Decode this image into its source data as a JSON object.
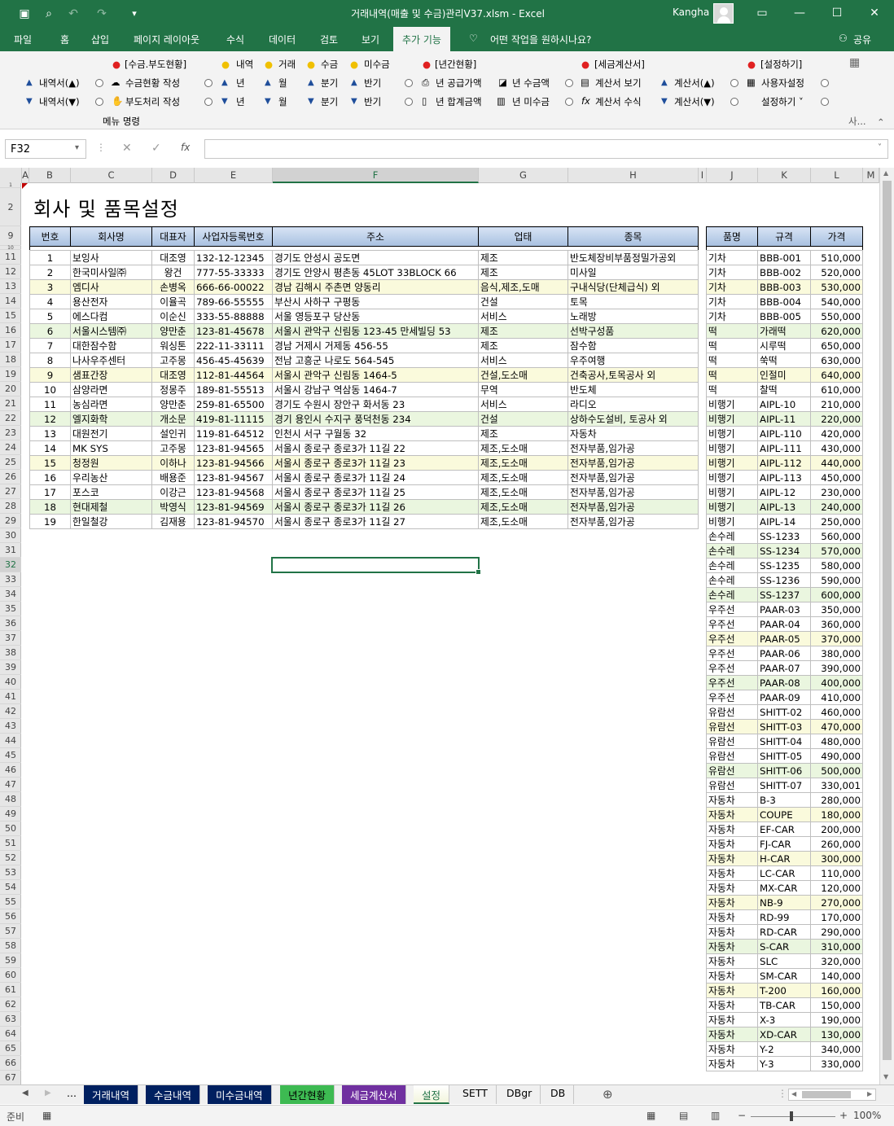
{
  "window": {
    "title": "거래내역(매출 및 수금)관리V37.xlsm  -  Excel",
    "user": "Kangha"
  },
  "menu": {
    "tabs": [
      "파일",
      "홈",
      "삽입",
      "페이지 레이아웃",
      "수식",
      "데이터",
      "검토",
      "보기",
      "추가 기능"
    ],
    "search": "어떤 작업을 원하시나요?",
    "share": "공유"
  },
  "ribbon": {
    "group_headers": [
      "[수금.부도현황]",
      "내역",
      "거래",
      "수금",
      "미수금",
      "[년간현황]",
      "[세금계산서]",
      "[설정하기]"
    ],
    "row1": [
      "내역서(▲)",
      "수금현황 작성",
      "년",
      "월",
      "분기",
      "반기",
      "년 공급가액",
      "년 수금액",
      "계산서 보기",
      "계산서(▲)",
      "사용자설정"
    ],
    "row2": [
      "내역서(▼)",
      "부도처리 작성",
      "년",
      "월",
      "분기",
      "반기",
      "년 합계금액",
      "년 미수금",
      "계산서 수식",
      "계산서(▼)",
      "설정하기 ˅"
    ],
    "caption": "메뉴 명령",
    "caption2": "사..."
  },
  "formula_bar": {
    "name_box": "F32",
    "value": ""
  },
  "columns": [
    "A",
    "B",
    "C",
    "D",
    "E",
    "F",
    "G",
    "H",
    "I",
    "J",
    "K",
    "L",
    "M"
  ],
  "sheet": {
    "title": "회사 및 품목설정",
    "company_headers": [
      "번호",
      "회사명",
      "대표자",
      "사업자등록번호",
      "주소",
      "업태",
      "종목"
    ],
    "companies": [
      [
        "1",
        "보잉사",
        "대조영",
        "132-12-12345",
        "경기도 안성시 공도면",
        "제조",
        "반도체장비부품정밀가공외"
      ],
      [
        "2",
        "한국미사일㈜",
        "왕건",
        "777-55-33333",
        "경기도 안양시 평촌동 45LOT 33BLOCK 66",
        "제조",
        "미사일"
      ],
      [
        "3",
        "엠디사",
        "손병옥",
        "666-66-00022",
        "경남 김해시 주촌면 양동리",
        "음식,제조,도매",
        "구내식당(단체급식) 외"
      ],
      [
        "4",
        "용산전자",
        "이율곡",
        "789-66-55555",
        "부산시 사하구 구평동",
        "건설",
        "토목"
      ],
      [
        "5",
        "에스다컴",
        "이순신",
        "333-55-88888",
        "서울 영등포구 당산동",
        "서비스",
        "노래방"
      ],
      [
        "6",
        "서울시스템㈜",
        "양만춘",
        "123-81-45678",
        "서울시 관악구 신림동 123-45 만세빌딩 53",
        "제조",
        "선박구성품"
      ],
      [
        "7",
        "대한잠수함",
        "워싱톤",
        "222-11-33111",
        "경남 거제시 거제동 456-55",
        "제조",
        "잠수함"
      ],
      [
        "8",
        "나사우주센터",
        "고주몽",
        "456-45-45639",
        "전남 고흥군 나로도 564-545",
        "서비스",
        "우주여행"
      ],
      [
        "9",
        "샘표간장",
        "대조영",
        "112-81-44564",
        "서울시 관악구 신림동 1464-5",
        "건설,도소매",
        "건축공사,토목공사 외"
      ],
      [
        "10",
        "삼양라면",
        "정몽주",
        "189-81-55513",
        "서울시 강남구 역삼동 1464-7",
        "무역",
        "반도체"
      ],
      [
        "11",
        "농심라면",
        "양만춘",
        "259-81-65500",
        "경기도 수원시 장안구 화서동 23",
        "서비스",
        "라디오"
      ],
      [
        "12",
        "엘지화학",
        "개소문",
        "419-81-11115",
        "경기 용인시 수지구 풍덕천동 234",
        "건설",
        "상하수도설비, 토공사 외"
      ],
      [
        "13",
        "대원전기",
        "설인귀",
        "119-81-64512",
        "인천시 서구 구월동 32",
        "제조",
        "자동차"
      ],
      [
        "14",
        "MK SYS",
        "고주몽",
        "123-81-94565",
        "서울시 종로구 종로3가 11길 22",
        "제조,도소매",
        "전자부품,임가공"
      ],
      [
        "15",
        "청정원",
        "이하나",
        "123-81-94566",
        "서울시 종로구 종로3가 11길 23",
        "제조,도소매",
        "전자부품,임가공"
      ],
      [
        "16",
        "우리농산",
        "배용준",
        "123-81-94567",
        "서울시 종로구 종로3가 11길 24",
        "제조,도소매",
        "전자부품,임가공"
      ],
      [
        "17",
        "포스코",
        "이강근",
        "123-81-94568",
        "서울시 종로구 종로3가 11길 25",
        "제조,도소매",
        "전자부품,임가공"
      ],
      [
        "18",
        "현대제철",
        "박영식",
        "123-81-94569",
        "서울시 종로구 종로3가 11길 26",
        "제조,도소매",
        "전자부품,임가공"
      ],
      [
        "19",
        "한일철강",
        "김재용",
        "123-81-94570",
        "서울시 종로구 종로3가 11길 27",
        "제조,도소매",
        "전자부품,임가공"
      ]
    ],
    "product_headers": [
      "품명",
      "규격",
      "가격"
    ],
    "products": [
      [
        "기차",
        "BBB-001",
        "510,000"
      ],
      [
        "기차",
        "BBB-002",
        "520,000"
      ],
      [
        "기차",
        "BBB-003",
        "530,000"
      ],
      [
        "기차",
        "BBB-004",
        "540,000"
      ],
      [
        "기차",
        "BBB-005",
        "550,000"
      ],
      [
        "떡",
        "가래떡",
        "620,000"
      ],
      [
        "떡",
        "시루떡",
        "650,000"
      ],
      [
        "떡",
        "쑥떡",
        "630,000"
      ],
      [
        "떡",
        "인절미",
        "640,000"
      ],
      [
        "떡",
        "찰떡",
        "610,000"
      ],
      [
        "비행기",
        "AIPL-10",
        "210,000"
      ],
      [
        "비행기",
        "AIPL-11",
        "220,000"
      ],
      [
        "비행기",
        "AIPL-110",
        "420,000"
      ],
      [
        "비행기",
        "AIPL-111",
        "430,000"
      ],
      [
        "비행기",
        "AIPL-112",
        "440,000"
      ],
      [
        "비행기",
        "AIPL-113",
        "450,000"
      ],
      [
        "비행기",
        "AIPL-12",
        "230,000"
      ],
      [
        "비행기",
        "AIPL-13",
        "240,000"
      ],
      [
        "비행기",
        "AIPL-14",
        "250,000"
      ],
      [
        "손수레",
        "SS-1233",
        "560,000"
      ],
      [
        "손수레",
        "SS-1234",
        "570,000"
      ],
      [
        "손수레",
        "SS-1235",
        "580,000"
      ],
      [
        "손수레",
        "SS-1236",
        "590,000"
      ],
      [
        "손수레",
        "SS-1237",
        "600,000"
      ],
      [
        "우주선",
        "PAAR-03",
        "350,000"
      ],
      [
        "우주선",
        "PAAR-04",
        "360,000"
      ],
      [
        "우주선",
        "PAAR-05",
        "370,000"
      ],
      [
        "우주선",
        "PAAR-06",
        "380,000"
      ],
      [
        "우주선",
        "PAAR-07",
        "390,000"
      ],
      [
        "우주선",
        "PAAR-08",
        "400,000"
      ],
      [
        "우주선",
        "PAAR-09",
        "410,000"
      ],
      [
        "유람선",
        "SHITT-02",
        "460,000"
      ],
      [
        "유람선",
        "SHITT-03",
        "470,000"
      ],
      [
        "유람선",
        "SHITT-04",
        "480,000"
      ],
      [
        "유람선",
        "SHITT-05",
        "490,000"
      ],
      [
        "유람선",
        "SHITT-06",
        "500,000"
      ],
      [
        "유람선",
        "SHITT-07",
        "330,001"
      ],
      [
        "자동차",
        "B-3",
        "280,000"
      ],
      [
        "자동차",
        "COUPE",
        "180,000"
      ],
      [
        "자동차",
        "EF-CAR",
        "200,000"
      ],
      [
        "자동차",
        "FJ-CAR",
        "260,000"
      ],
      [
        "자동차",
        "H-CAR",
        "300,000"
      ],
      [
        "자동차",
        "LC-CAR",
        "110,000"
      ],
      [
        "자동차",
        "MX-CAR",
        "120,000"
      ],
      [
        "자동차",
        "NB-9",
        "270,000"
      ],
      [
        "자동차",
        "RD-99",
        "170,000"
      ],
      [
        "자동차",
        "RD-CAR",
        "290,000"
      ],
      [
        "자동차",
        "S-CAR",
        "310,000"
      ],
      [
        "자동차",
        "SLC",
        "320,000"
      ],
      [
        "자동차",
        "SM-CAR",
        "140,000"
      ],
      [
        "자동차",
        "T-200",
        "160,000"
      ],
      [
        "자동차",
        "TB-CAR",
        "150,000"
      ],
      [
        "자동차",
        "X-3",
        "190,000"
      ],
      [
        "자동차",
        "XD-CAR",
        "130,000"
      ],
      [
        "자동차",
        "Y-2",
        "340,000"
      ],
      [
        "자동차",
        "Y-3",
        "330,000"
      ]
    ]
  },
  "sheet_tabs": [
    "...",
    "거래내역",
    "수금내역",
    "미수금내역",
    "년간현황",
    "세금계산서",
    "설정",
    "SETT",
    "DBgr",
    "DB"
  ],
  "status": {
    "ready": "준비",
    "zoom": "100%"
  }
}
